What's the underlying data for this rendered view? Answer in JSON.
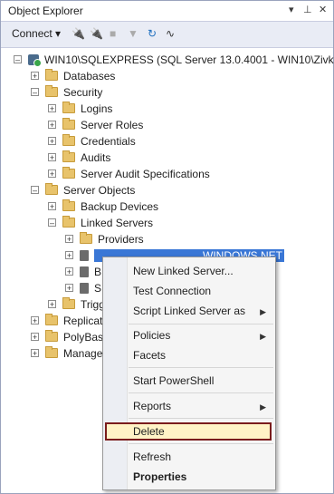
{
  "window": {
    "title": "Object Explorer",
    "controls": [
      "▾",
      "⊥",
      "✕"
    ]
  },
  "toolbar": {
    "connect_label": "Connect ▾"
  },
  "tree": {
    "server": "WIN10\\SQLEXPRESS (SQL Server 13.0.4001 - WIN10\\Zivko)",
    "databases": "Databases",
    "security": "Security",
    "logins": "Logins",
    "server_roles": "Server Roles",
    "credentials": "Credentials",
    "audits": "Audits",
    "server_audit_specs": "Server Audit Specifications",
    "server_objects": "Server Objects",
    "backup_devices": "Backup Devices",
    "linked_servers": "Linked Servers",
    "providers": "Providers",
    "linked_selected": "WINDOWS.NET",
    "linked2": "B",
    "linked3": "S",
    "triggers": "Trigg",
    "replication": "Replicat",
    "polybase": "PolyBas",
    "management": "Manage"
  },
  "context_menu": {
    "new_linked_server": "New Linked Server...",
    "test_connection": "Test Connection",
    "script_linked_server": "Script Linked Server as",
    "policies": "Policies",
    "facets": "Facets",
    "start_powershell": "Start PowerShell",
    "reports": "Reports",
    "delete": "Delete",
    "refresh": "Refresh",
    "properties": "Properties"
  },
  "colors": {
    "selection": "#3a77d6",
    "delete_highlight": "#fff3c6",
    "delete_border": "#7a1c1c"
  }
}
